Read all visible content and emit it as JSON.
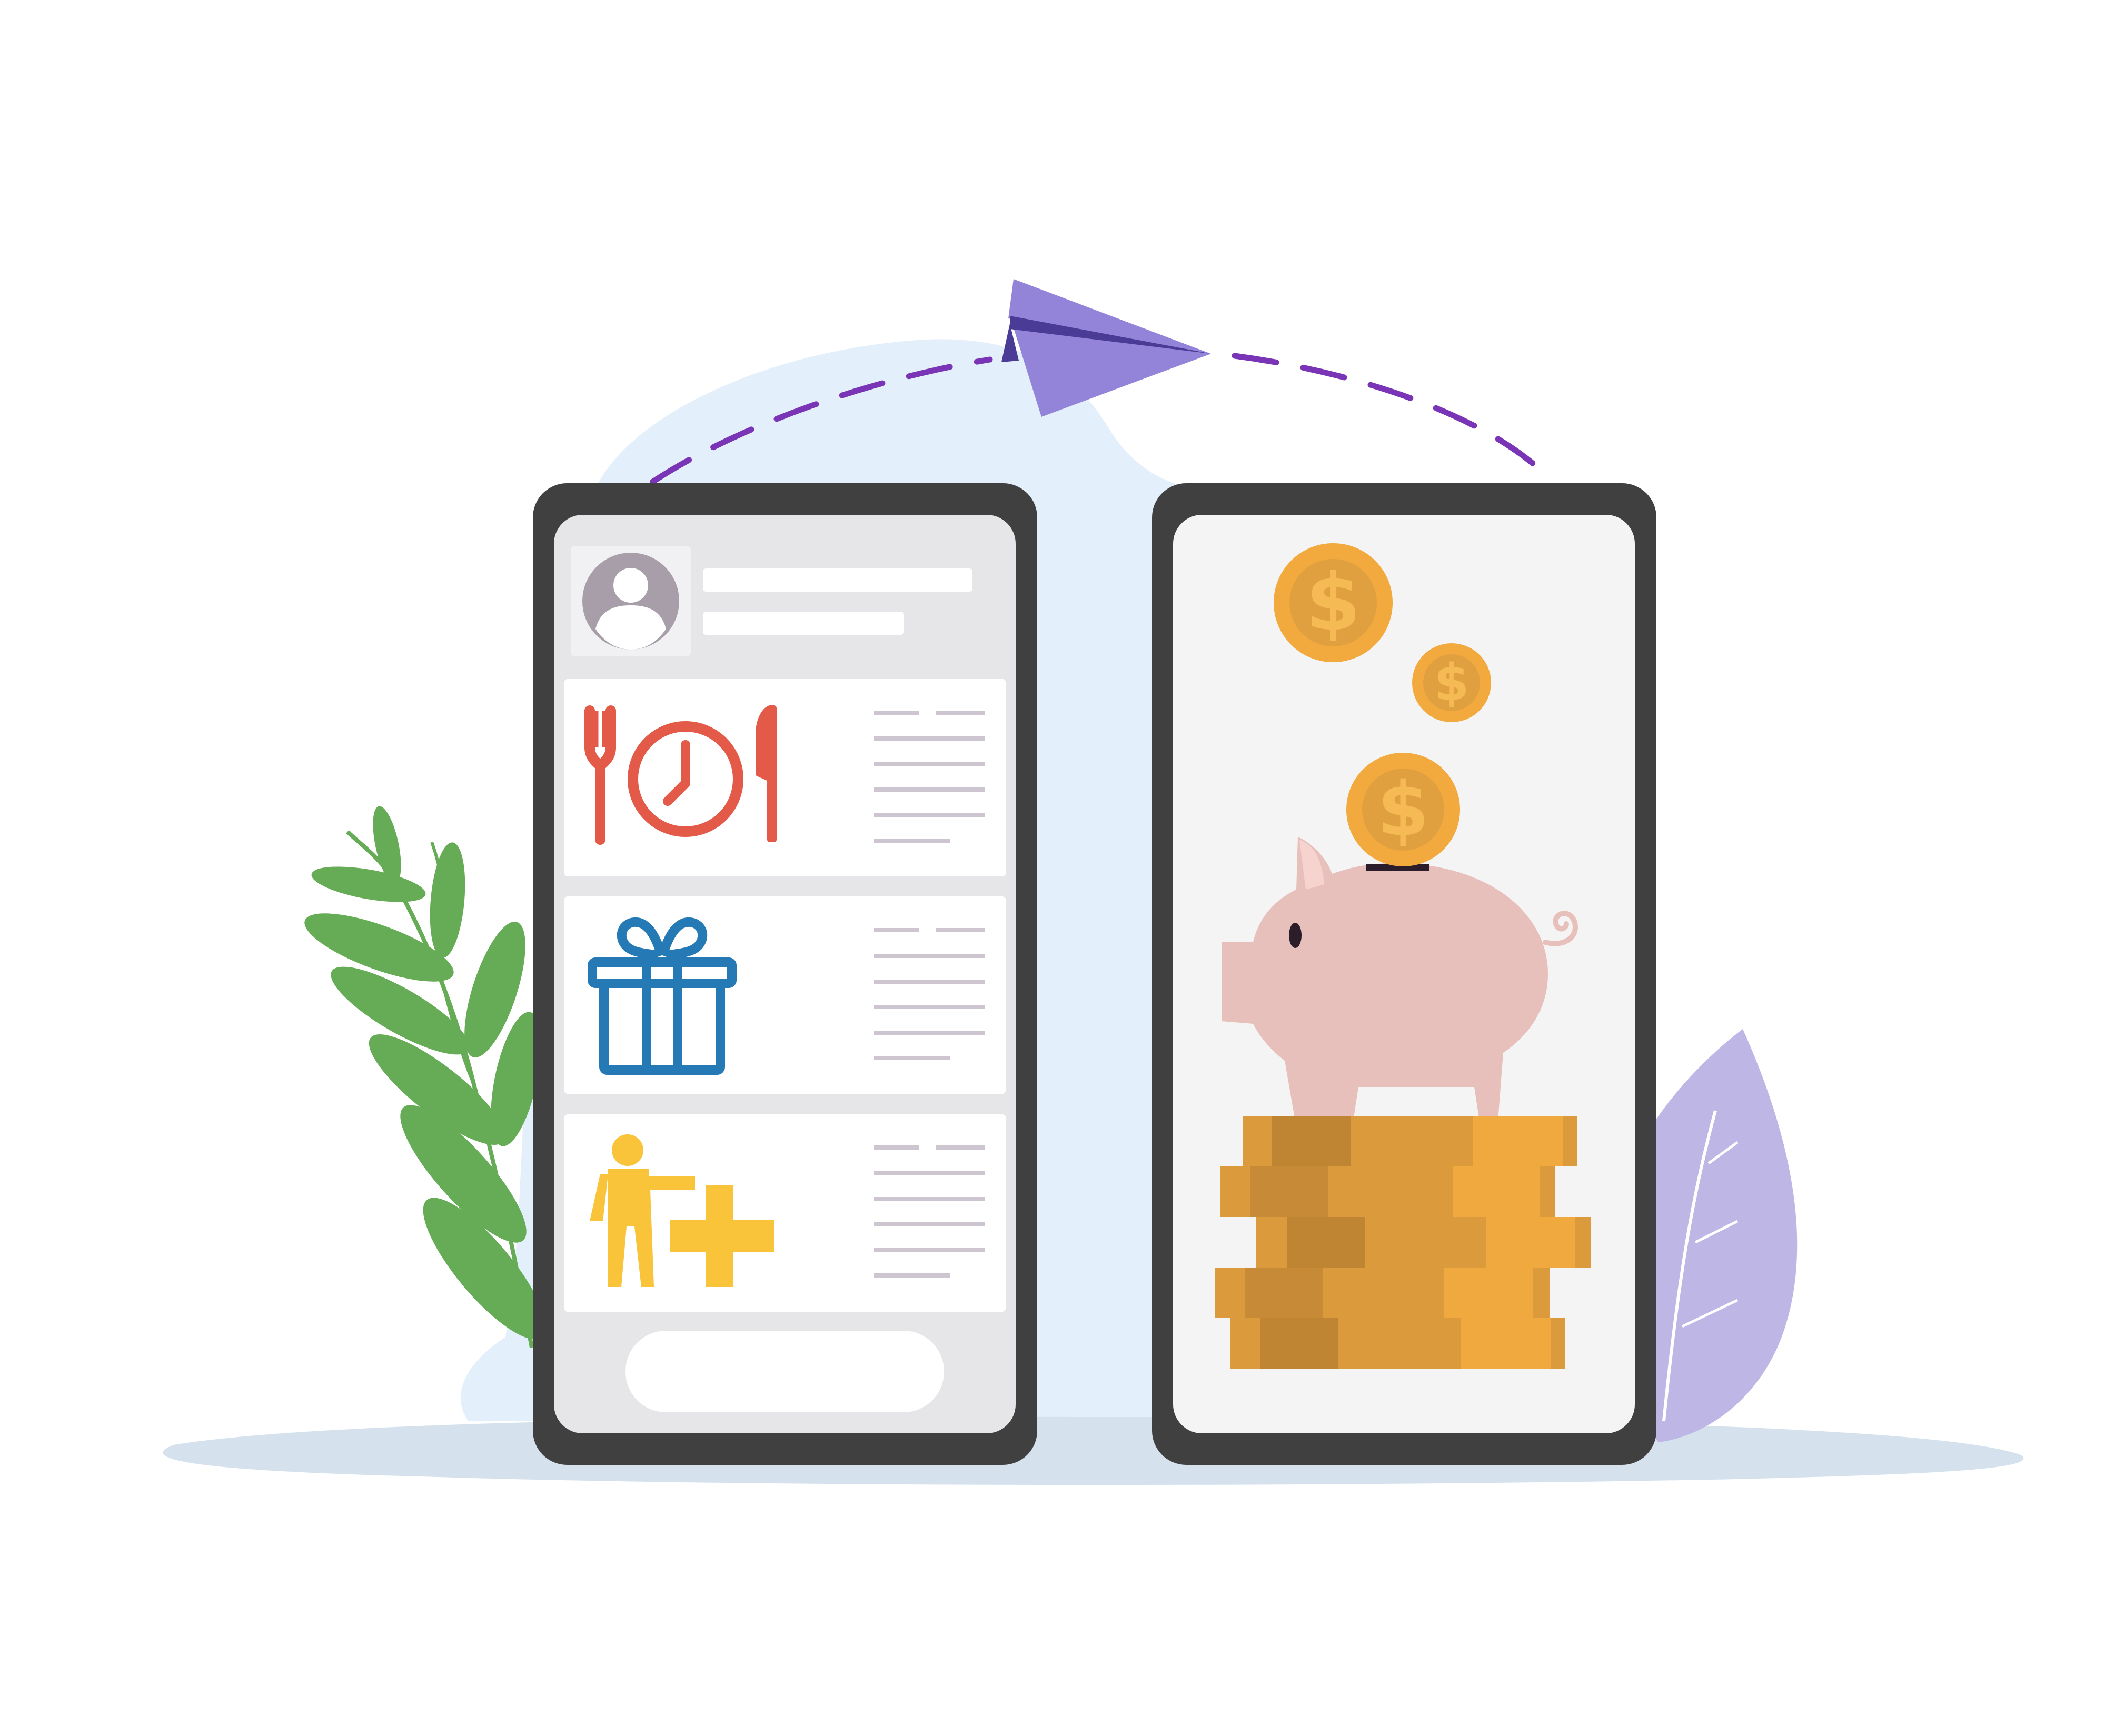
{
  "illustration": {
    "subject": "",
    "colors": {
      "background": "#ffffff",
      "blob": "#e3effa",
      "floor_shadow": "#d5e2ee",
      "phone_frame": "#404040",
      "phone_screen_left": "#e6e5e8",
      "phone_screen_right": "#f4f4f4",
      "card": "#ffffff",
      "text_lines": "#cdc6d0",
      "avatar": "#a79ea9",
      "plane_light": "#9384d9",
      "plane_dark": "#4a3c96",
      "dash_path": "#7a35b6",
      "restaurant_icon": "#e35a48",
      "gift_icon": "#2579b4",
      "add_user_icon": "#f9c33a",
      "coin_outer": "#f2aa3e",
      "coin_inner": "#e0a040",
      "coin_symbol": "#f6ba55",
      "piggy": "#e8c0bb",
      "leaf_green": "#66ab55",
      "leaf_purple": "#beb6e5"
    },
    "icons": {
      "profile": "user-avatar-icon",
      "card_1": "restaurant-time-icon",
      "card_2": "gift-icon",
      "card_3": "add-user-icon",
      "coins": "dollar-coin-icon",
      "bank": "piggy-bank-icon",
      "transfer": "paper-plane-icon"
    }
  },
  "left_phone": {
    "cards": [
      {
        "icon": "restaurant-time-icon"
      },
      {
        "icon": "gift-icon"
      },
      {
        "icon": "add-user-icon"
      }
    ]
  },
  "right_phone": {
    "coin_symbol": "$"
  }
}
